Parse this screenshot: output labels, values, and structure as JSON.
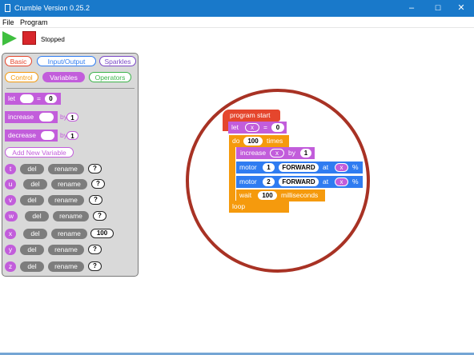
{
  "window": {
    "title": "Crumble Version 0.25.2",
    "minimize": "–",
    "maximize": "☐",
    "close": "✕"
  },
  "menu": {
    "file": "File",
    "program": "Program"
  },
  "toolbar": {
    "status": "Stopped"
  },
  "palette": {
    "categories": [
      "Basic",
      "Input/Output",
      "Sparkles",
      "Control",
      "Variables",
      "Operators"
    ],
    "let_block": {
      "label": "let",
      "eq": "=",
      "value": "0"
    },
    "increase_block": {
      "label": "increase",
      "by": "by",
      "value": "1"
    },
    "decrease_block": {
      "label": "decrease",
      "by": "by",
      "value": "1"
    },
    "add_variable": "Add New Variable",
    "del_label": "del",
    "rename_label": "rename",
    "variables": [
      {
        "name": "t",
        "value": "?"
      },
      {
        "name": "u",
        "value": "?"
      },
      {
        "name": "v",
        "value": "?"
      },
      {
        "name": "w",
        "value": "?"
      },
      {
        "name": "x",
        "value": "100"
      },
      {
        "name": "y",
        "value": "?"
      },
      {
        "name": "z",
        "value": "?"
      }
    ]
  },
  "program": {
    "start": "program start",
    "let": "let",
    "let_var": "x",
    "let_eq": "=",
    "let_val": "0",
    "do": "do",
    "do_count": "100",
    "do_times": "times",
    "inc": "increase",
    "inc_var": "x",
    "inc_by": "by",
    "inc_val": "1",
    "motor_label": "motor",
    "motor_dir": "FORWARD",
    "motor_at": "at",
    "motor_var": "x",
    "motor_pct": "%",
    "motor1_num": "1",
    "motor2_num": "2",
    "wait": "wait",
    "wait_val": "100",
    "wait_unit": "milliseconds",
    "loop": "loop"
  },
  "colors": {
    "titlebar": "#1979ca",
    "purple": "#c25ddb",
    "orange": "#f59a0d",
    "blue": "#2f7cf1",
    "red": "#e5462d",
    "circle": "#a83224"
  }
}
